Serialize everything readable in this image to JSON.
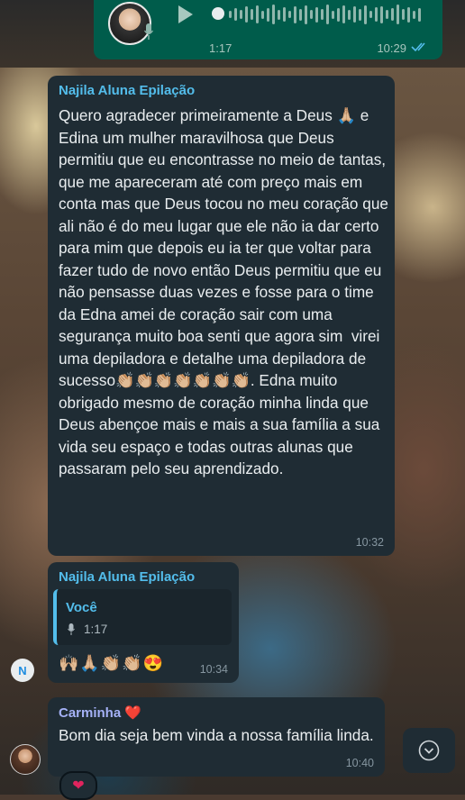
{
  "voice_message": {
    "duration": "1:17",
    "time": "10:29"
  },
  "message1": {
    "sender": "Najila Aluna Epilação",
    "text": "Quero agradecer primeiramente a Deus 🙏🏼 e  Edina um mulher maravilhosa que Deus permitiu que eu encontrasse no meio de tantas, que me apareceram até com preço mais em conta mas que Deus tocou no meu coração que ali não é do meu lugar que ele não ia dar certo para mim que depois eu ia ter que voltar para fazer tudo de novo então Deus permitiu que eu não pensasse duas vezes e fosse para o time da Edna amei de coração sair com uma segurança muito boa senti que agora sim  virei uma depiladora e detalhe uma depiladora de sucesso👏🏼👏🏼👏🏼👏🏼👏🏼👏🏼👏🏼. Edna muito obrigado mesmo de coração minha linda que Deus abençoe mais e mais a sua família a sua vida seu espaço e todas outras alunas que passaram pelo seu aprendizado.",
    "time": "10:32"
  },
  "message2": {
    "sender": "Najila Aluna Epilação",
    "quote_name": "Você",
    "quote_duration": "1:17",
    "emojis": "🙌🏼🙏🏼👏🏼👏🏼😍",
    "time": "10:34",
    "avatar_letter": "N"
  },
  "message3": {
    "sender": "Carminha ❤️",
    "text": "Bom dia seja bem vinda a nossa família linda.",
    "time": "10:40",
    "reaction": "❤"
  },
  "colors": {
    "incoming_bubble": "#1f2c34",
    "outgoing_bubble": "#005c4b",
    "sender_name": "#53bdeb",
    "sender_name_alt": "#a5b2f7"
  },
  "icons": [
    "mic-icon",
    "play-icon",
    "double-check-icon",
    "chevron-down-icon"
  ]
}
